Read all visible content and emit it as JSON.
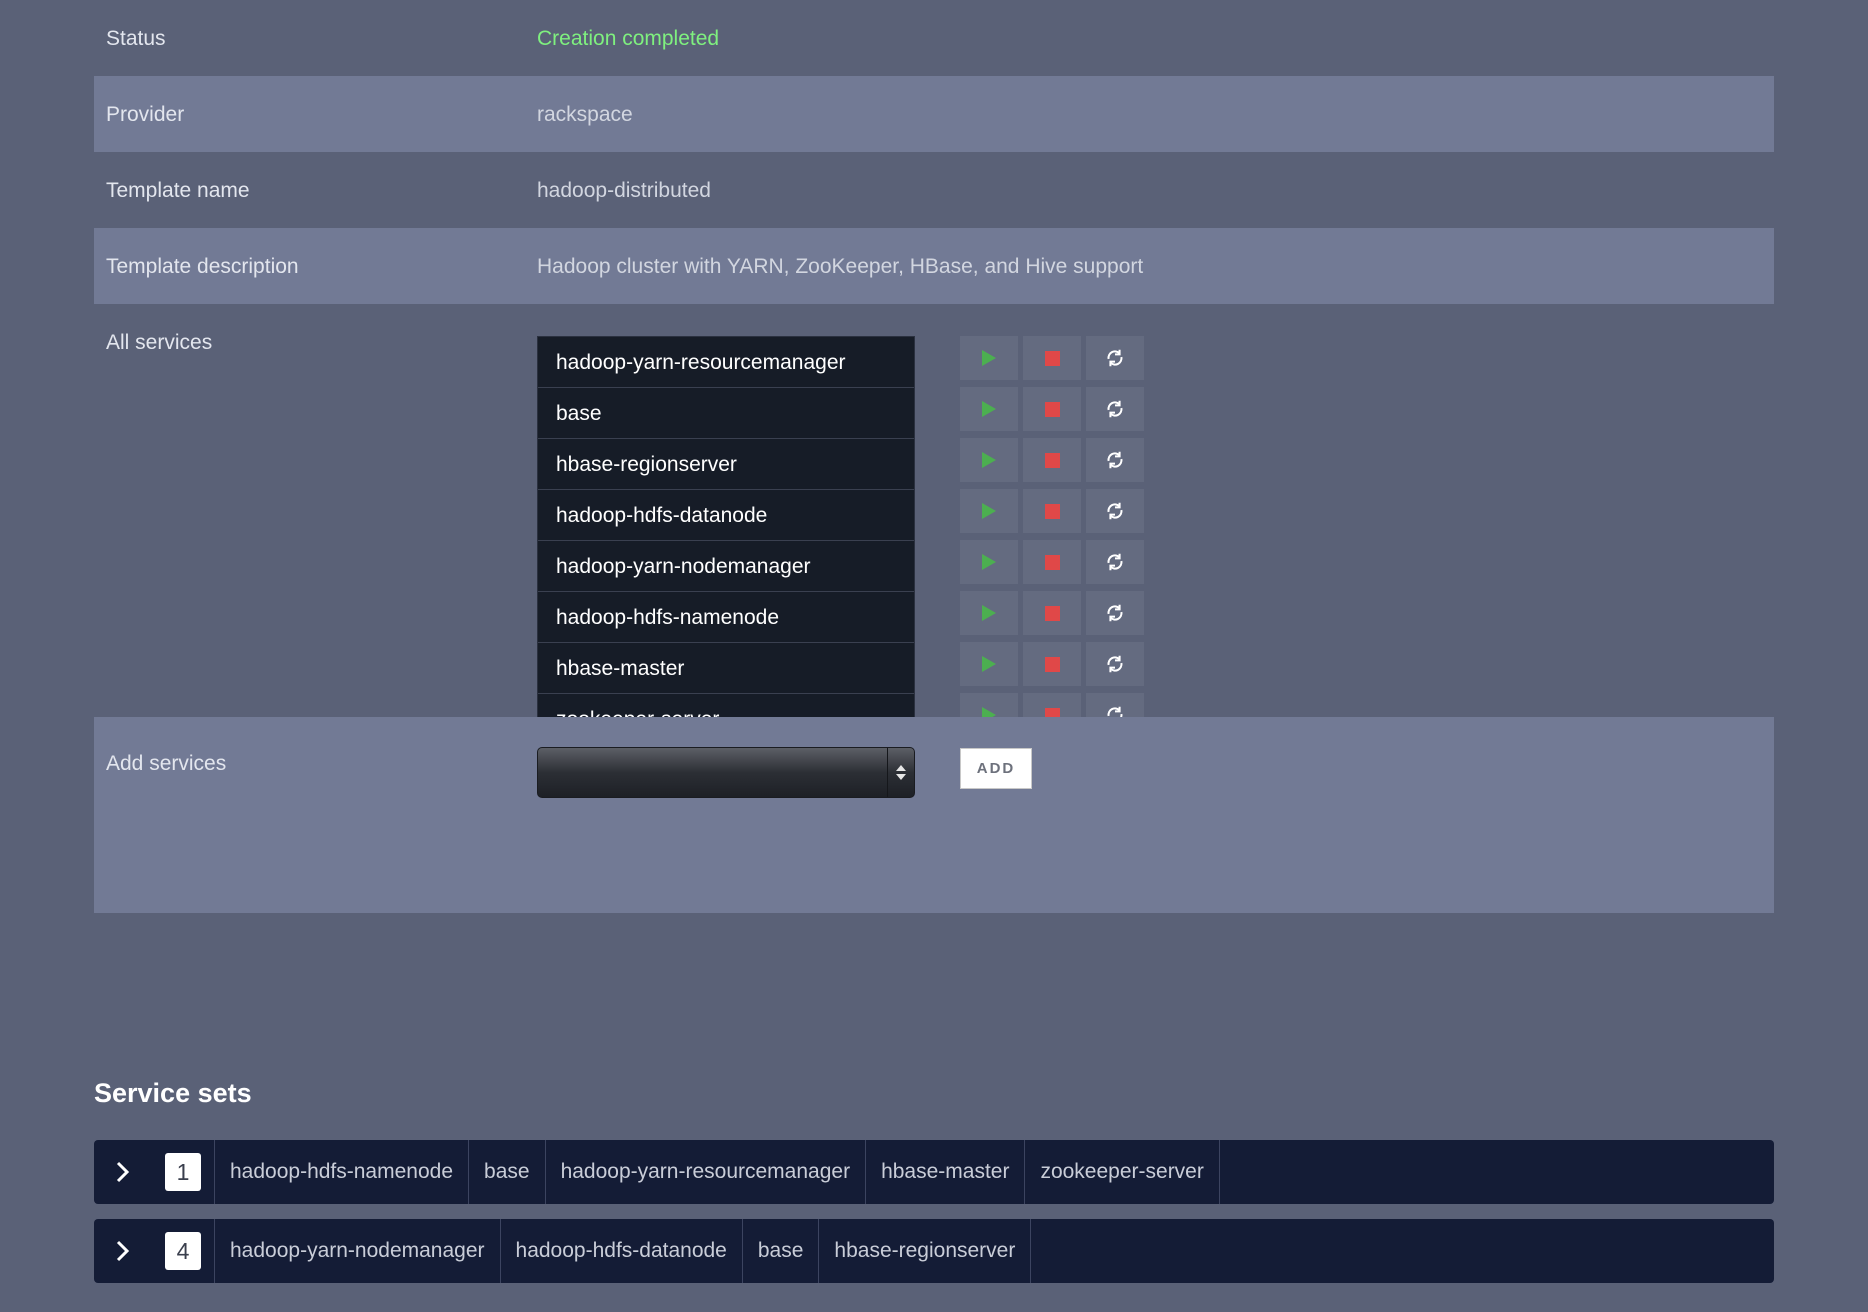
{
  "details": {
    "status_label": "Status",
    "status_value": "Creation completed",
    "provider_label": "Provider",
    "provider_value": "rackspace",
    "template_name_label": "Template name",
    "template_name_value": "hadoop-distributed",
    "template_description_label": "Template description",
    "template_description_value": "Hadoop cluster with YARN, ZooKeeper, HBase, and Hive support",
    "all_services_label": "All services",
    "add_services_label": "Add services"
  },
  "services": [
    "hadoop-yarn-resourcemanager",
    "base",
    "hbase-regionserver",
    "hadoop-hdfs-datanode",
    "hadoop-yarn-nodemanager",
    "hadoop-hdfs-namenode",
    "hbase-master",
    "zookeeper-server"
  ],
  "service_controls": {
    "icons": [
      "play-icon",
      "stop-icon",
      "refresh-icon"
    ],
    "colors": {
      "play": "#4caf50",
      "stop": "#e04848",
      "refresh": "#ffffff"
    }
  },
  "add_services": {
    "select_value": "",
    "add_label": "ADD"
  },
  "service_sets": {
    "title": "Service sets",
    "sets": [
      {
        "count": "1",
        "services": [
          "hadoop-hdfs-namenode",
          "base",
          "hadoop-yarn-resourcemanager",
          "hbase-master",
          "zookeeper-server"
        ]
      },
      {
        "count": "4",
        "services": [
          "hadoop-yarn-nodemanager",
          "hadoop-hdfs-datanode",
          "base",
          "hbase-regionserver"
        ]
      }
    ]
  },
  "colors": {
    "background": "#5a6177",
    "row_alt": "#727a95",
    "status_green": "#7ff07f",
    "set_bar": "#141c36"
  }
}
